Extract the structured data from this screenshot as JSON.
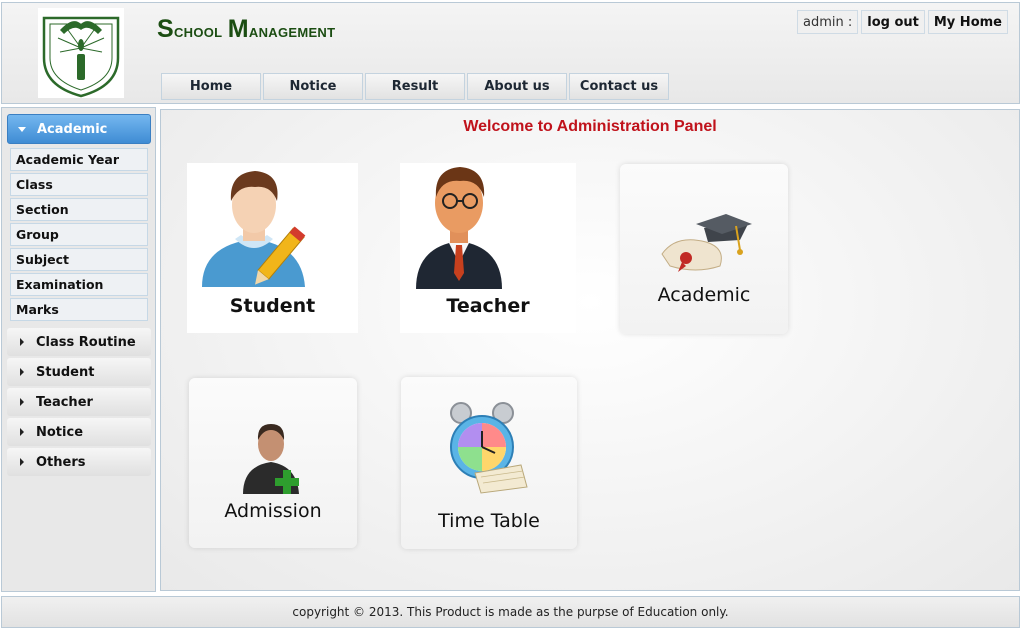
{
  "header": {
    "title_first_letter": "S",
    "title_rest": "chool ",
    "title_second_letter": "M",
    "title_rest2": "anagement",
    "nav": [
      "Home",
      "Notice",
      "Result",
      "About us",
      "Contact us"
    ],
    "user_label": "admin :",
    "logout_label": "log out",
    "myhome_label": "My Home"
  },
  "sidebar": {
    "active_section": "Academic",
    "sub_items": [
      "Academic Year",
      "Class",
      "Section",
      "Group",
      "Subject",
      "Examination",
      "Marks"
    ],
    "sections": [
      "Class Routine",
      "Student",
      "Teacher",
      "Notice",
      "Others"
    ]
  },
  "main": {
    "welcome": "Welcome to Administration Panel",
    "tiles": {
      "student": "Student",
      "teacher": "Teacher",
      "academic": "Academic",
      "admission": "Admission",
      "timetable": "Time Table"
    }
  },
  "footer": {
    "text": "copyright © 2013. This Product is made as the purpse of Education only."
  },
  "colors": {
    "accent": "#3f8cd4",
    "title_green": "#1b4d12",
    "welcome_red": "#c0121b"
  },
  "icons": [
    "school-logo-icon",
    "student-icon",
    "teacher-icon",
    "graduation-cap-icon",
    "admission-user-icon",
    "alarm-clock-icon"
  ]
}
